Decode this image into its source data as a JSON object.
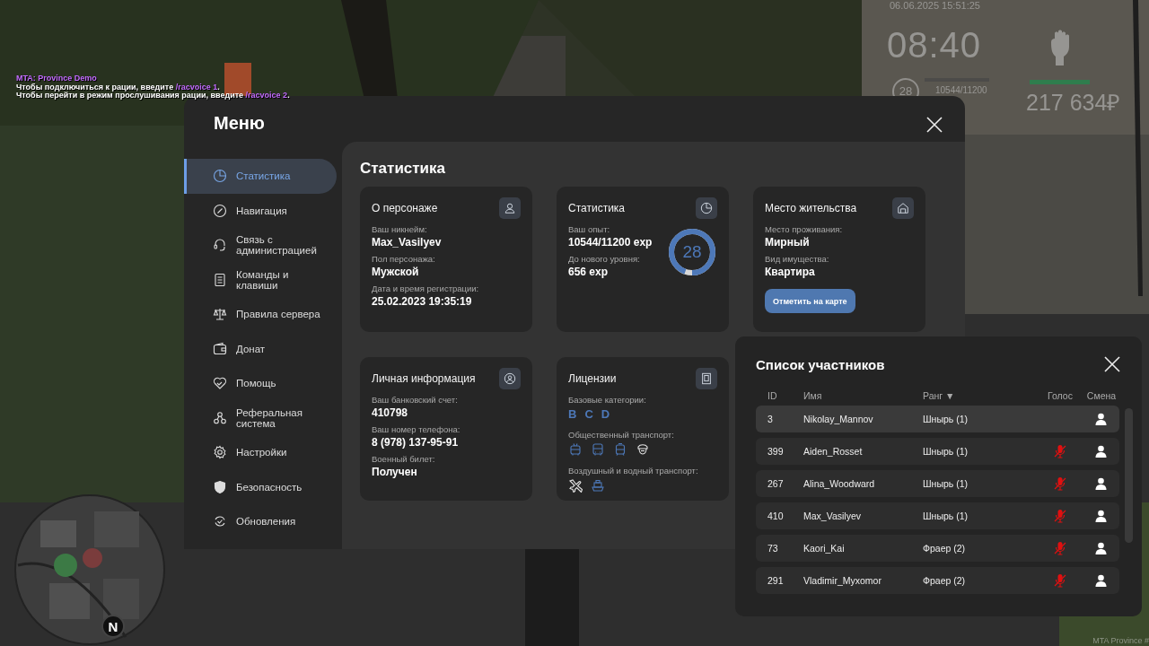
{
  "chat": [
    {
      "segments": [
        {
          "text": "MTA: Province Demo",
          "highlight": true
        }
      ]
    },
    {
      "segments": [
        {
          "text": "Чтобы подключиться к рации, введите ",
          "highlight": false
        },
        {
          "text": "/racvoice 1",
          "highlight": true
        },
        {
          "text": ".",
          "highlight": false
        }
      ]
    },
    {
      "segments": [
        {
          "text": "Чтобы перейти в режим прослушивания рации, введите ",
          "highlight": false
        },
        {
          "text": "/racvoice 2",
          "highlight": true
        },
        {
          "text": ".",
          "highlight": false
        }
      ]
    }
  ],
  "hud": {
    "datetime": "06.06.2025 15:51:25",
    "clock": "08:40",
    "level": "28",
    "experience": "10544/11200",
    "money": "217 634₽"
  },
  "menu": {
    "title": "Меню",
    "sidebar": {
      "items": [
        {
          "label": "Статистика",
          "selected": true
        },
        {
          "label": "Навигация",
          "selected": false
        },
        {
          "label": "Связь с администрацией",
          "selected": false
        },
        {
          "label": "Команды и клавиши",
          "selected": false
        },
        {
          "label": "Правила сервера",
          "selected": false
        },
        {
          "label": "Донат",
          "selected": false
        },
        {
          "label": "Помощь",
          "selected": false
        },
        {
          "label": "Реферальная система",
          "selected": false
        },
        {
          "label": "Настройки",
          "selected": false
        },
        {
          "label": "Безопасность",
          "selected": false
        },
        {
          "label": "Обновления",
          "selected": false
        }
      ]
    },
    "content": {
      "title": "Статистика",
      "cards": [
        {
          "kind": "fields",
          "title": "О персонаже",
          "fields": [
            {
              "label": "Ваш никнейм:",
              "value": "Max_Vasilyev"
            },
            {
              "label": "Пол персонажа:",
              "value": "Мужской"
            },
            {
              "label": "Дата и время регистрации:",
              "value": "25.02.2023 19:35:19"
            }
          ]
        },
        {
          "kind": "experience",
          "title": "Статистика",
          "fields": [
            {
              "label": "Ваш опыт:",
              "value": "10544/11200 exp"
            },
            {
              "label": "До нового уровня:",
              "value": "656 exp"
            }
          ],
          "ring": {
            "text": "28",
            "level": 0.94
          }
        },
        {
          "kind": "fields",
          "title": "Место жительства",
          "fields": [
            {
              "label": "Место проживания:",
              "value": "Мирный"
            },
            {
              "label": "Вид имущества:",
              "value": "Квартира"
            }
          ],
          "button": "Отметить на карте"
        },
        {
          "kind": "fields",
          "title": "Личная информация",
          "fields": [
            {
              "label": "Ваш банковский счет:",
              "value": "410798"
            },
            {
              "label": "Ваш номер телефона:",
              "value": "8 (978) 137-95-91"
            },
            {
              "label": "Военный билет:",
              "value": "Получен"
            }
          ]
        },
        {
          "kind": "licenses",
          "title": "Лицензии",
          "base_label": "Базовые категории:",
          "categories": [
            "B",
            "C",
            "D"
          ],
          "groups": [
            {
              "label": "Общественный транспорт:",
              "vehicles": [
                {
                  "kind": "trolleybus",
                  "licensed": true
                },
                {
                  "kind": "bus",
                  "licensed": true
                },
                {
                  "kind": "tram",
                  "licensed": true
                },
                {
                  "kind": "cap",
                  "licensed": false
                }
              ]
            },
            {
              "label": "Воздушный и водный транспорт:",
              "vehicles": [
                {
                  "kind": "plane",
                  "licensed": false
                },
                {
                  "kind": "boat",
                  "licensed": true
                }
              ]
            }
          ]
        }
      ]
    }
  },
  "participants": {
    "title": "Список участников",
    "columns": [
      "ID",
      "Имя",
      "Ранг ▼",
      "Голос",
      "Смена"
    ],
    "rows": [
      {
        "id": "3",
        "name": "Nikolay_Mannov",
        "rank": "Шнырь (1)",
        "voice_muted": false,
        "selected": true
      },
      {
        "id": "399",
        "name": "Aiden_Rosset",
        "rank": "Шнырь (1)",
        "voice_muted": true,
        "selected": false
      },
      {
        "id": "267",
        "name": "Alina_Woodward",
        "rank": "Шнырь (1)",
        "voice_muted": true,
        "selected": false
      },
      {
        "id": "410",
        "name": "Max_Vasilyev",
        "rank": "Шнырь (1)",
        "voice_muted": true,
        "selected": false
      },
      {
        "id": "73",
        "name": "Kaori_Kai",
        "rank": "Фраер (2)",
        "voice_muted": true,
        "selected": false
      },
      {
        "id": "291",
        "name": "Vladimir_Myxomor",
        "rank": "Фраер (2)",
        "voice_muted": true,
        "selected": false
      }
    ]
  },
  "minimap": {
    "compass_label": "N"
  },
  "watermark_corner": "MTA Province #"
}
